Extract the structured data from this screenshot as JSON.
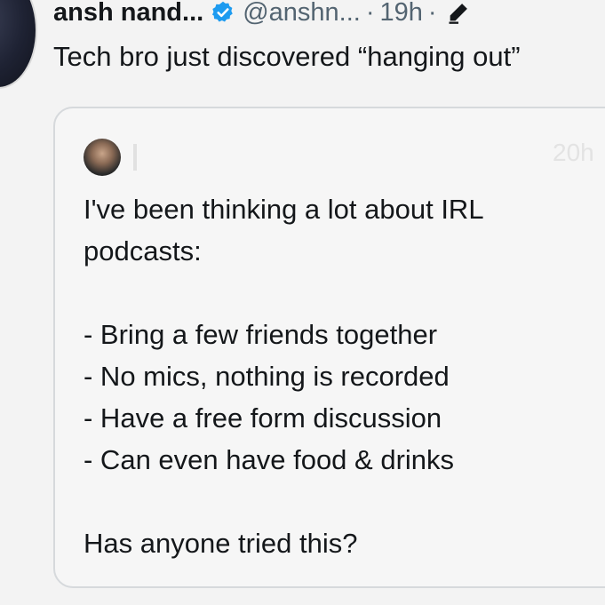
{
  "tweet": {
    "display_name": "ansh nand...",
    "handle": "@anshn...",
    "time_separator": "·",
    "time": "19h",
    "time_separator_2": "·",
    "text": "Tech bro just discovered “hanging out”"
  },
  "quoted_tweet": {
    "time": "20h",
    "lines": [
      "I've been thinking a lot about IRL",
      "podcasts:",
      "",
      "- Bring a few friends together",
      "- No mics, nothing is recorded",
      "- Have a free form discussion",
      "- Can even have food & drinks",
      "",
      "Has anyone tried this?"
    ]
  },
  "colors": {
    "background": "#f3f3f3",
    "text": "#14171a",
    "secondary_text": "#536471",
    "verified_blue": "#1d9bf0",
    "card_border": "#d6d9dc"
  },
  "icons": {
    "verified": "verified-badge-icon",
    "edit": "edit-pencil-icon"
  }
}
